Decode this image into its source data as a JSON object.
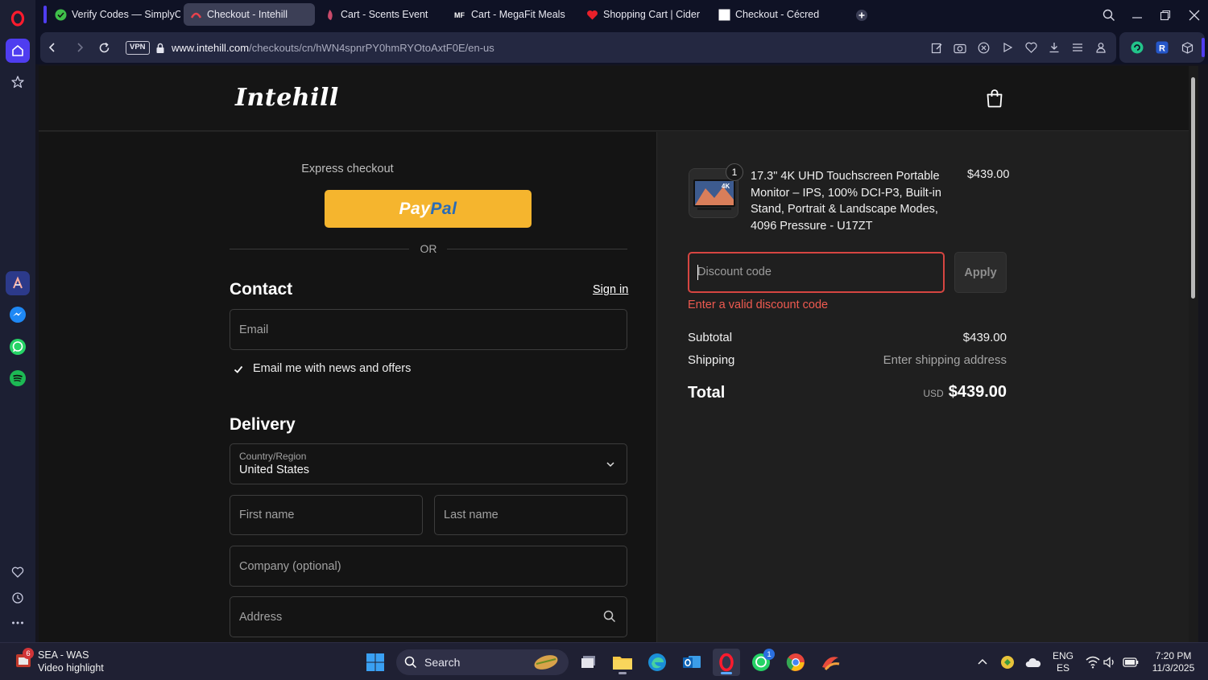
{
  "browser": {
    "tabs": [
      {
        "title": "Verify Codes — SimplyCodes",
        "active": false
      },
      {
        "title": "Checkout - Intehill",
        "active": true
      },
      {
        "title": "Cart - Scents Event",
        "active": false
      },
      {
        "title": "Cart - MegaFit Meals",
        "active": false
      },
      {
        "title": "Shopping Cart | Cider",
        "active": false
      },
      {
        "title": "Checkout - Cécred",
        "active": false
      }
    ],
    "vpn_label": "VPN",
    "url_domain": "www.intehill.com",
    "url_path": "/checkouts/cn/hWN4spnrPY0hmRYOtoAxtF0E/en-us",
    "ext_letter": "R"
  },
  "store": {
    "logo": "Intehill"
  },
  "checkout": {
    "express_label": "Express checkout",
    "paypal_label_1": "Pay",
    "paypal_label_2": "Pal",
    "or_label": "OR",
    "contact_heading": "Contact",
    "sign_in": "Sign in",
    "email_placeholder": "Email",
    "news_label": "Email me with news and offers",
    "news_checked": true,
    "delivery_heading": "Delivery",
    "country_label": "Country/Region",
    "country_value": "United States",
    "first_name_placeholder": "First name",
    "last_name_placeholder": "Last name",
    "company_placeholder": "Company (optional)",
    "address_placeholder": "Address"
  },
  "summary": {
    "product_name": "17.3\" 4K UHD Touchscreen Portable Monitor – IPS, 100% DCI-P3, Built-in Stand, Portrait & Landscape Modes, 4096 Pressure - U17ZT",
    "product_qty": "1",
    "product_price": "$439.00",
    "thumb_text": "4K",
    "discount_placeholder": "Discount code",
    "apply_label": "Apply",
    "discount_error": "Enter a valid discount code",
    "subtotal_label": "Subtotal",
    "subtotal_value": "$439.00",
    "shipping_label": "Shipping",
    "shipping_value": "Enter shipping address",
    "total_label": "Total",
    "total_currency": "USD",
    "total_value": "$439.00"
  },
  "taskbar": {
    "weather_badge": "6",
    "weather_line1": "SEA - WAS",
    "weather_line2": "Video highlight",
    "search_label": "Search",
    "whatsapp_badge": "1",
    "lang_1": "ENG",
    "lang_2": "ES",
    "time": "7:20 PM",
    "date": "11/3/2025"
  },
  "colors": {
    "accent": "#4f3df0",
    "paypal_yellow": "#f5b52e",
    "error_red": "#d64541"
  }
}
